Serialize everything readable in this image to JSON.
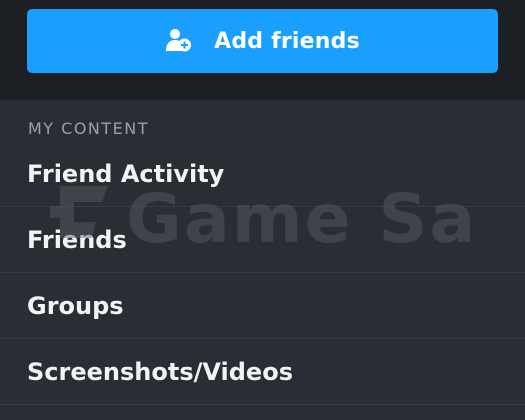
{
  "header": {
    "add_friends_label": "Add friends",
    "add_friends_icon": "add-friend-icon",
    "accent_color": "#1a9fff"
  },
  "my_content": {
    "section_title": "MY CONTENT",
    "items": [
      {
        "label": "Friend Activity"
      },
      {
        "label": "Friends"
      },
      {
        "label": "Groups"
      },
      {
        "label": "Screenshots/Videos"
      }
    ]
  },
  "watermark": {
    "text": "Game Satis"
  }
}
